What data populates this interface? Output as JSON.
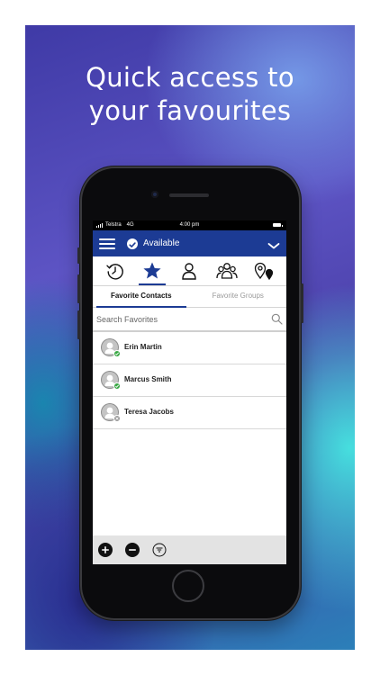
{
  "headline": {
    "line1": "Quick access to",
    "line2": "your favourites"
  },
  "statusbar": {
    "carrier": "Telstra",
    "network": "4G",
    "time": "4:00 pm"
  },
  "appbar": {
    "status": "Available"
  },
  "icon_tabs": [
    "recent-icon",
    "favorites-star-icon",
    "contact-icon",
    "groups-icon",
    "locations-icon"
  ],
  "subtabs": {
    "contacts": "Favorite Contacts",
    "groups": "Favorite Groups"
  },
  "search": {
    "placeholder": "Search Favorites"
  },
  "contacts": [
    {
      "name": "Erin Martin",
      "presence": "available"
    },
    {
      "name": "Marcus Smith",
      "presence": "available"
    },
    {
      "name": "Teresa Jacobs",
      "presence": "offline"
    }
  ],
  "colors": {
    "primary": "#1c3b94",
    "available": "#3aa845",
    "offline": "#9a9a9a"
  },
  "bottom_actions": [
    "add-icon",
    "remove-icon",
    "filter-icon"
  ]
}
